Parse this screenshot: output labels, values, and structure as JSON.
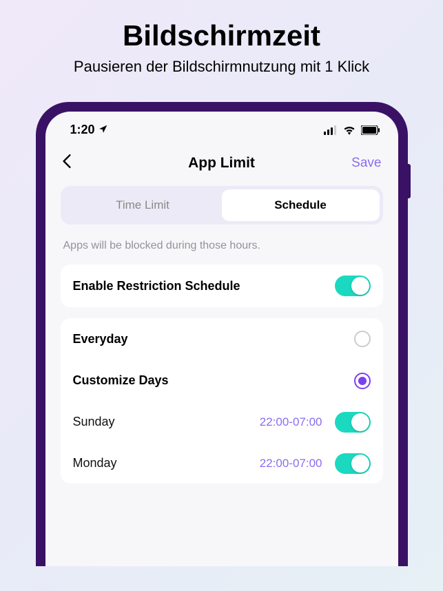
{
  "marketing": {
    "title": "Bildschirmzeit",
    "subtitle": "Pausieren der Bildschirmnutzung mit 1 Klick"
  },
  "statusBar": {
    "time": "1:20"
  },
  "nav": {
    "title": "App  Limit",
    "save": "Save"
  },
  "tabs": {
    "timeLimit": "Time Limit",
    "schedule": "Schedule"
  },
  "description": "Apps will be blocked during those hours.",
  "enableRow": {
    "label": "Enable Restriction Schedule"
  },
  "options": {
    "everyday": "Everyday",
    "customize": "Customize Days"
  },
  "days": [
    {
      "name": "Sunday",
      "time": "22:00-07:00"
    },
    {
      "name": "Monday",
      "time": "22:00-07:00"
    }
  ]
}
